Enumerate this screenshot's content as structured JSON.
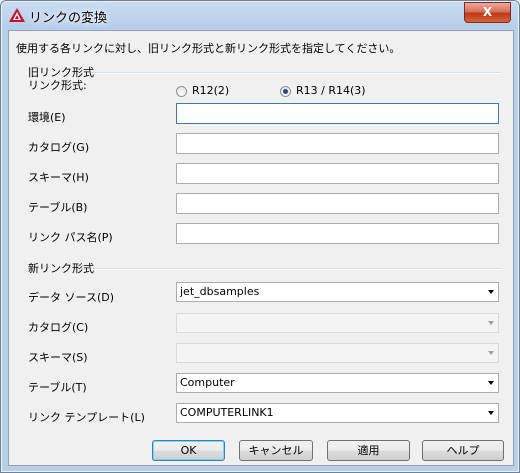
{
  "window": {
    "title": "リンクの変換",
    "close_label": "X"
  },
  "description": "使用する各リンクに対し、旧リンク形式と新リンク形式を指定してください。",
  "old_link": {
    "group_label": "旧リンク形式",
    "format_label": "リンク形式:",
    "radio_r12": "R12(2)",
    "radio_r13": "R13 / R14(3)",
    "selected": "R13 / R14(3)",
    "environment_label": "環境(E)",
    "catalog_label": "カタログ(G)",
    "schema_label": "スキーマ(H)",
    "table_label": "テーブル(B)",
    "path_label": "リンク パス名(P)",
    "environment_value": "",
    "catalog_value": "",
    "schema_value": "",
    "table_value": "",
    "path_value": ""
  },
  "new_link": {
    "group_label": "新リンク形式",
    "datasource_label": "データ ソース(D)",
    "datasource_value": "jet_dbsamples",
    "catalog_label": "カタログ(C)",
    "catalog_value": "",
    "schema_label": "スキーマ(S)",
    "schema_value": "",
    "table_label": "テーブル(T)",
    "table_value": "Computer",
    "template_label": "リンク テンプレート(L)",
    "template_value": "COMPUTERLINK1"
  },
  "buttons": {
    "ok": "OK",
    "cancel": "キャンセル",
    "apply": "適用",
    "help": "ヘルプ"
  }
}
